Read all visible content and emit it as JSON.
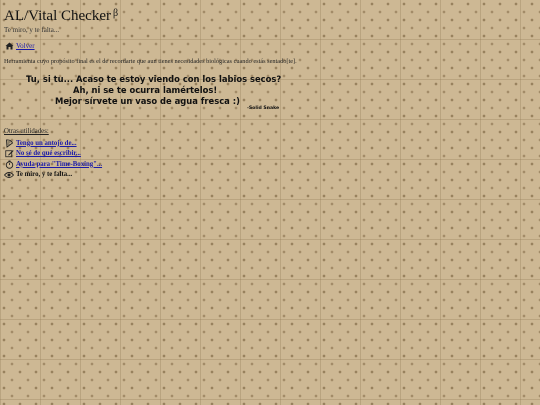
{
  "header": {
    "title": "AL/Vital Checker",
    "beta": "β",
    "subtitle": "Te miro, y te falta..."
  },
  "nav": {
    "back_label": "Volver",
    "back_icon": "home-icon"
  },
  "description": "Herramienta cuyo propósito final es el de recordarte que aun tienes necesidades biológicas cuando estás sentado[te].",
  "quote": {
    "line1": "Tu, si tu... Acaso te estoy viendo con los labios secos?",
    "line2": "Ah, ni se te ocurra lamértelos!",
    "line3": "Mejor sírvete un vaso de agua fresca :)",
    "author": "-Solid Snake"
  },
  "utilities": {
    "title": "Otras utilidades:",
    "items": [
      {
        "label": "Tengo un antojo de...",
        "icon": "utensils-icon",
        "link": true
      },
      {
        "label": "No sé de qué escribir...",
        "icon": "pencil-square-icon",
        "link": true
      },
      {
        "label": "Ayuda para \"Time-Boxing\"...",
        "icon": "stopwatch-icon",
        "link": true
      },
      {
        "label": "Te miro, y te falta...",
        "icon": "eye-icon",
        "link": false
      }
    ]
  },
  "colors": {
    "background": "#cdb894",
    "link": "#1a1aa8",
    "text": "#222222"
  }
}
